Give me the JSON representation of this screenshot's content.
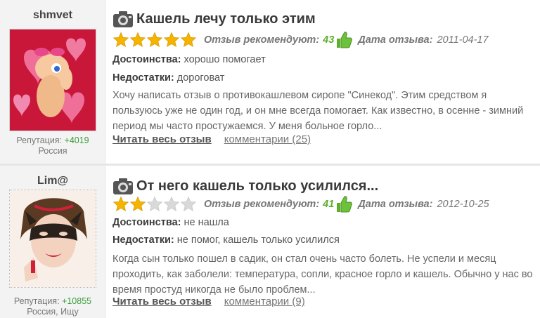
{
  "reviews": [
    {
      "username": "shmvet",
      "reputation_label": "Репутация:",
      "reputation_value": "+4019",
      "location": "Россия",
      "title": "Кашель лечу только этим",
      "rating": 5,
      "max_rating": 5,
      "recommend_label": "Отзыв рекомендуют:",
      "recommend_count": "43",
      "date_label": "Дата отзыва:",
      "date": "2011-04-17",
      "pros_label": "Достоинства:",
      "pros": "хорошо помогает",
      "cons_label": "Недостатки:",
      "cons": "дороговат",
      "excerpt": "Хочу написать отзыв о противокашлевом сиропе \"Синекод\". Этим средством я пользуюсь уже не один год, и он мне всегда помогает. Как известно, в осенне - зимний период мы часто простужаемся. У меня больное горло...",
      "read_more": "Читать весь отзыв",
      "comments": "комментарии (25)"
    },
    {
      "username": "Lim@",
      "reputation_label": "Репутация:",
      "reputation_value": "+10855",
      "location": "Россия, Ищу",
      "title": "От него кашель только усилился...",
      "rating": 2,
      "max_rating": 5,
      "recommend_label": "Отзыв рекомендуют:",
      "recommend_count": "41",
      "date_label": "Дата отзыва:",
      "date": "2012-10-25",
      "pros_label": "Достоинства:",
      "pros": "не нашла",
      "cons_label": "Недостатки:",
      "cons": "не помог, кашель только усилился",
      "excerpt": "Когда сын только пошел в садик, он стал очень часто болеть. Не успели и месяц проходить, как заболели: температура, сопли, красное горло и кашель. Обычно у нас во время простуд никогда не было проблем...",
      "read_more": "Читать весь отзыв",
      "comments": "комментарии (9)"
    }
  ],
  "icons": {
    "camera": "camera-icon",
    "star": "star-icon",
    "thumb": "thumbs-up-icon"
  },
  "colors": {
    "star_filled": "#f5b400",
    "star_empty": "#d9d9d9",
    "recommend": "#5fae2e",
    "reputation": "#3c9b3c"
  }
}
